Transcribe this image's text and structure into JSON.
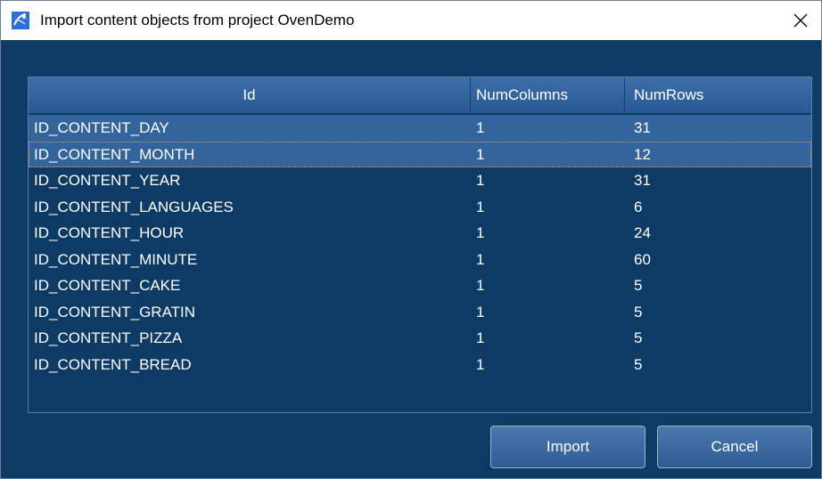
{
  "window": {
    "title": "Import content objects from project OvenDemo",
    "icon": "app-icon",
    "close_icon": "close-icon"
  },
  "table": {
    "columns": [
      "Id",
      "NumColumns",
      "NumRows"
    ],
    "rows": [
      {
        "id": "ID_CONTENT_DAY",
        "num_columns": "1",
        "num_rows": "31"
      },
      {
        "id": "ID_CONTENT_MONTH",
        "num_columns": "1",
        "num_rows": "12"
      },
      {
        "id": "ID_CONTENT_YEAR",
        "num_columns": "1",
        "num_rows": "31"
      },
      {
        "id": "ID_CONTENT_LANGUAGES",
        "num_columns": "1",
        "num_rows": "6"
      },
      {
        "id": "ID_CONTENT_HOUR",
        "num_columns": "1",
        "num_rows": "24"
      },
      {
        "id": "ID_CONTENT_MINUTE",
        "num_columns": "1",
        "num_rows": "60"
      },
      {
        "id": "ID_CONTENT_CAKE",
        "num_columns": "1",
        "num_rows": "5"
      },
      {
        "id": "ID_CONTENT_GRATIN",
        "num_columns": "1",
        "num_rows": "5"
      },
      {
        "id": "ID_CONTENT_PIZZA",
        "num_columns": "1",
        "num_rows": "5"
      },
      {
        "id": "ID_CONTENT_BREAD",
        "num_columns": "1",
        "num_rows": "5"
      }
    ],
    "selected_rows": [
      0,
      1
    ],
    "focused_row": 1
  },
  "buttons": {
    "import_label": "Import",
    "cancel_label": "Cancel"
  },
  "colors": {
    "background": "#0e3a66",
    "header": "#3d6ea9",
    "selection": "#34649c",
    "text": "#ffffff"
  }
}
